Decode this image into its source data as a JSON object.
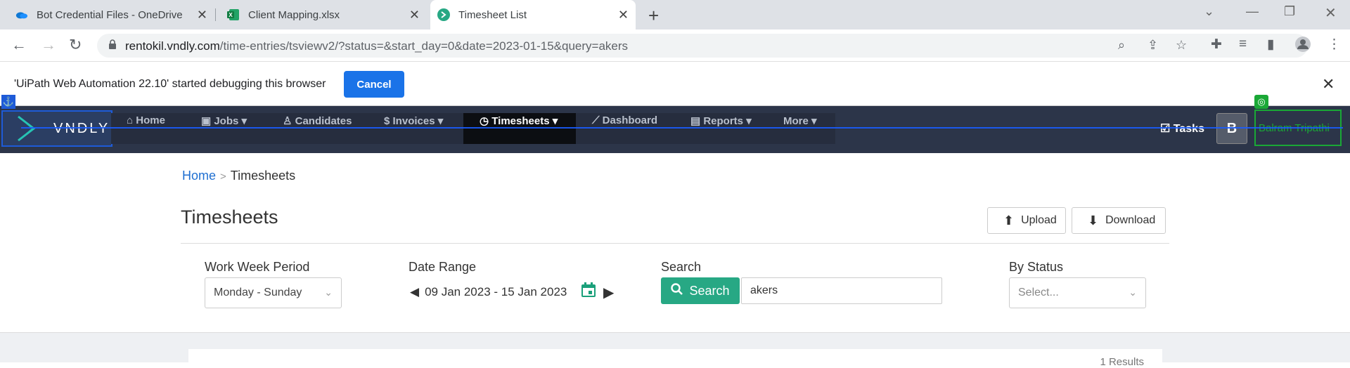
{
  "browser": {
    "tabs": [
      {
        "title": "Bot Credential Files - OneDrive",
        "active": false,
        "icon": "onedrive-icon"
      },
      {
        "title": "Client Mapping.xlsx",
        "active": false,
        "icon": "excel-icon"
      },
      {
        "title": "Timesheet List",
        "active": true,
        "icon": "vndly-icon"
      }
    ],
    "url_host": "rentokil.vndly.com",
    "url_path": "/time-entries/tsviewv2/?status=&start_day=0&date=2023-01-15&query=akers"
  },
  "debug_bar": {
    "message": "'UiPath Web Automation 22.10' started debugging this browser",
    "cancel_label": "Cancel"
  },
  "app_nav": {
    "logo": "VNDLY",
    "items": [
      "Home",
      "Jobs",
      "Candidates",
      "Invoices",
      "Timesheets",
      "Dashboard",
      "Reports",
      "More"
    ],
    "active": "Timesheets",
    "tasks_label": "Tasks",
    "avatar_letter": "B",
    "user_name": "Balram Tripathi"
  },
  "breadcrumb": {
    "home": "Home",
    "separator": ">",
    "current": "Timesheets"
  },
  "page": {
    "title": "Timesheets",
    "upload_label": "Upload",
    "download_label": "Download"
  },
  "filters": {
    "work_week_label": "Work Week Period",
    "work_week_value": "Monday - Sunday",
    "date_range_label": "Date Range",
    "date_range_value": "09 Jan 2023 - 15 Jan 2023",
    "search_label": "Search",
    "search_button": "Search",
    "search_value": "akers",
    "status_label": "By Status",
    "status_placeholder": "Select..."
  },
  "results": {
    "text": "1 Results"
  },
  "colors": {
    "accent": "#27a884",
    "nav_bg": "#2c3549",
    "link": "#1f6fd1",
    "chrome_blue": "#1a73e8"
  }
}
